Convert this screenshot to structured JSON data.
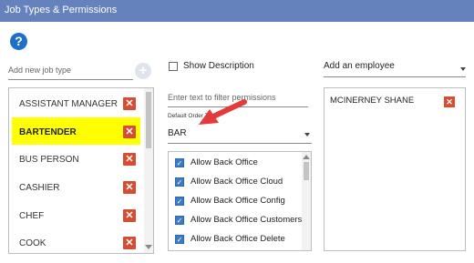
{
  "window": {
    "title": "Job Types & Permissions"
  },
  "help_icon_glyph": "?",
  "new_job": {
    "placeholder": "Add new job type",
    "add_glyph": "+"
  },
  "job_types": {
    "items": [
      {
        "label": "ASSISTANT MANAGER",
        "selected": false
      },
      {
        "label": "BARTENDER",
        "selected": true
      },
      {
        "label": "BUS PERSON",
        "selected": false
      },
      {
        "label": "CASHIER",
        "selected": false
      },
      {
        "label": "CHEF",
        "selected": false
      },
      {
        "label": "COOK",
        "selected": false
      }
    ],
    "delete_glyph": "✕"
  },
  "show_description": {
    "label": "Show Description",
    "checked": false
  },
  "filter": {
    "placeholder": "Enter text to filter permissions"
  },
  "default_order": {
    "label": "Default Order T",
    "value": "BAR"
  },
  "permissions": {
    "items": [
      {
        "label": "Allow Back Office",
        "checked": true
      },
      {
        "label": "Allow Back Office Cloud",
        "checked": true
      },
      {
        "label": "Allow Back Office Config",
        "checked": true
      },
      {
        "label": "Allow Back Office Customers",
        "checked": true
      },
      {
        "label": "Allow Back Office Delete",
        "checked": true
      }
    ],
    "check_glyph": "✓"
  },
  "employees": {
    "dropdown_label": "Add an employee",
    "items": [
      {
        "name": "MCINERNEY SHANE"
      }
    ],
    "delete_glyph": "✕"
  },
  "colors": {
    "title_bar": "#6582bd",
    "selected_row": "#ffff00",
    "delete_button": "#d84d31",
    "checkbox": "#3d7cc4",
    "annotation_arrow": "#e53a3a"
  }
}
